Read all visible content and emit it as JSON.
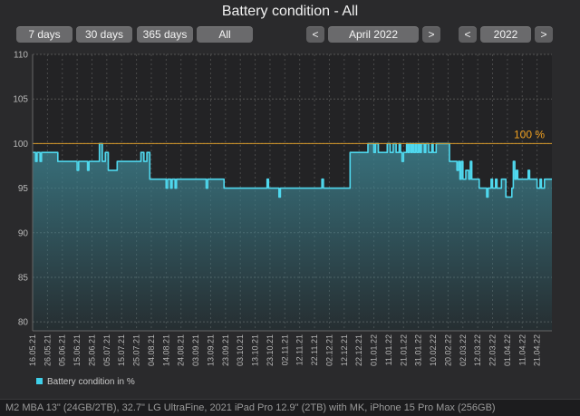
{
  "window": {
    "title": "Battery condition - All"
  },
  "range_buttons": [
    "7 days",
    "30 days",
    "365 days",
    "All"
  ],
  "month_nav": {
    "prev": "<",
    "label": "April 2022",
    "next": ">"
  },
  "year_nav": {
    "prev": "<",
    "label": "2022",
    "next": ">"
  },
  "footer_text": "M2 MBA 13\" (24GB/2TB), 32.7\" LG UltraFine, 2021 iPad Pro 12.9\" (2TB) with MK, iPhone 15 Pro Max (256GB)",
  "colors": {
    "line": "#4fd8ee",
    "fill_top": "#3c7f8c",
    "reference": "#d89a2a",
    "reference_label": "#f0a020",
    "legend_swatch": "#3fd0ea"
  },
  "chart_data": {
    "type": "area",
    "title": "Battery condition - All",
    "ylim": [
      79,
      110
    ],
    "yticks": [
      80,
      85,
      90,
      95,
      100,
      105,
      110
    ],
    "xlim": [
      "2021-05-16",
      "2022-05-01"
    ],
    "xticks": [
      "16.05.21",
      "26.05.21",
      "05.06.21",
      "15.06.21",
      "25.06.21",
      "05.07.21",
      "15.07.21",
      "25.07.21",
      "04.08.21",
      "14.08.21",
      "24.08.21",
      "03.09.21",
      "13.09.21",
      "23.09.21",
      "03.10.21",
      "13.10.21",
      "23.10.21",
      "02.11.21",
      "12.11.21",
      "22.11.21",
      "02.12.21",
      "12.12.21",
      "22.12.21",
      "01.01.22",
      "11.01.22",
      "21.01.22",
      "31.01.22",
      "10.02.22",
      "20.02.22",
      "02.03.22",
      "12.03.22",
      "22.03.22",
      "01.04.22",
      "11.04.22",
      "21.04.22"
    ],
    "grid": true,
    "reference_line": {
      "value": 100,
      "label": "100 %"
    },
    "legend": {
      "position": "bottom-left",
      "entries": [
        "Battery condition in %"
      ]
    },
    "series": [
      {
        "name": "Battery condition in %",
        "points": [
          [
            "2021-05-16",
            99
          ],
          [
            "2021-05-18",
            98
          ],
          [
            "2021-05-19",
            99
          ],
          [
            "2021-05-21",
            98
          ],
          [
            "2021-05-22",
            99
          ],
          [
            "2021-06-01",
            99
          ],
          [
            "2021-06-02",
            98
          ],
          [
            "2021-06-14",
            98
          ],
          [
            "2021-06-15",
            97
          ],
          [
            "2021-06-16",
            98
          ],
          [
            "2021-06-21",
            98
          ],
          [
            "2021-06-22",
            97
          ],
          [
            "2021-06-23",
            98
          ],
          [
            "2021-06-29",
            98
          ],
          [
            "2021-06-30",
            100
          ],
          [
            "2021-07-02",
            98
          ],
          [
            "2021-07-04",
            99
          ],
          [
            "2021-07-06",
            97
          ],
          [
            "2021-07-11",
            97
          ],
          [
            "2021-07-12",
            98
          ],
          [
            "2021-07-27",
            98
          ],
          [
            "2021-07-28",
            99
          ],
          [
            "2021-07-30",
            98
          ],
          [
            "2021-08-01",
            99
          ],
          [
            "2021-08-03",
            96
          ],
          [
            "2021-08-13",
            96
          ],
          [
            "2021-08-14",
            95
          ],
          [
            "2021-08-15",
            96
          ],
          [
            "2021-08-17",
            95
          ],
          [
            "2021-08-18",
            96
          ],
          [
            "2021-08-20",
            95
          ],
          [
            "2021-08-21",
            96
          ],
          [
            "2021-09-09",
            96
          ],
          [
            "2021-09-10",
            95
          ],
          [
            "2021-09-11",
            96
          ],
          [
            "2021-09-20",
            96
          ],
          [
            "2021-09-22",
            95
          ],
          [
            "2021-10-20",
            95
          ],
          [
            "2021-10-21",
            96
          ],
          [
            "2021-10-22",
            95
          ],
          [
            "2021-10-28",
            95
          ],
          [
            "2021-10-29",
            94
          ],
          [
            "2021-10-30",
            95
          ],
          [
            "2021-11-26",
            95
          ],
          [
            "2021-11-27",
            96
          ],
          [
            "2021-11-28",
            95
          ],
          [
            "2021-12-14",
            95
          ],
          [
            "2021-12-16",
            99
          ],
          [
            "2021-12-27",
            99
          ],
          [
            "2021-12-28",
            100
          ],
          [
            "2021-12-31",
            100
          ],
          [
            "2022-01-01",
            99
          ],
          [
            "2022-01-02",
            100
          ],
          [
            "2022-01-04",
            99
          ],
          [
            "2022-01-09",
            99
          ],
          [
            "2022-01-10",
            100
          ],
          [
            "2022-01-12",
            99
          ],
          [
            "2022-01-14",
            100
          ],
          [
            "2022-01-16",
            99
          ],
          [
            "2022-01-18",
            100
          ],
          [
            "2022-01-19",
            99
          ],
          [
            "2022-01-20",
            98
          ],
          [
            "2022-01-21",
            99
          ],
          [
            "2022-01-23",
            100
          ],
          [
            "2022-01-24",
            99
          ],
          [
            "2022-01-25",
            100
          ],
          [
            "2022-01-26",
            99
          ],
          [
            "2022-01-27",
            100
          ],
          [
            "2022-01-28",
            99
          ],
          [
            "2022-01-29",
            100
          ],
          [
            "2022-01-30",
            99
          ],
          [
            "2022-01-31",
            100
          ],
          [
            "2022-02-01",
            99
          ],
          [
            "2022-02-02",
            100
          ],
          [
            "2022-02-04",
            99
          ],
          [
            "2022-02-05",
            100
          ],
          [
            "2022-02-07",
            99
          ],
          [
            "2022-02-09",
            100
          ],
          [
            "2022-02-10",
            99
          ],
          [
            "2022-02-12",
            100
          ],
          [
            "2022-02-20",
            100
          ],
          [
            "2022-02-21",
            98
          ],
          [
            "2022-02-25",
            98
          ],
          [
            "2022-02-26",
            97
          ],
          [
            "2022-02-27",
            98
          ],
          [
            "2022-02-28",
            96
          ],
          [
            "2022-03-01",
            98
          ],
          [
            "2022-03-02",
            96
          ],
          [
            "2022-03-04",
            97
          ],
          [
            "2022-03-06",
            96
          ],
          [
            "2022-03-07",
            98
          ],
          [
            "2022-03-08",
            96
          ],
          [
            "2022-03-12",
            96
          ],
          [
            "2022-03-13",
            95
          ],
          [
            "2022-03-17",
            95
          ],
          [
            "2022-03-18",
            94
          ],
          [
            "2022-03-19",
            95
          ],
          [
            "2022-03-21",
            96
          ],
          [
            "2022-03-22",
            95
          ],
          [
            "2022-03-24",
            96
          ],
          [
            "2022-03-25",
            95
          ],
          [
            "2022-03-27",
            95
          ],
          [
            "2022-03-28",
            96
          ],
          [
            "2022-03-30",
            96
          ],
          [
            "2022-03-31",
            94
          ],
          [
            "2022-04-03",
            94
          ],
          [
            "2022-04-04",
            95
          ],
          [
            "2022-04-05",
            98
          ],
          [
            "2022-04-06",
            96
          ],
          [
            "2022-04-07",
            97
          ],
          [
            "2022-04-08",
            96
          ],
          [
            "2022-04-14",
            96
          ],
          [
            "2022-04-15",
            97
          ],
          [
            "2022-04-16",
            96
          ],
          [
            "2022-04-20",
            96
          ],
          [
            "2022-04-21",
            95
          ],
          [
            "2022-04-23",
            96
          ],
          [
            "2022-04-24",
            95
          ],
          [
            "2022-04-26",
            96
          ]
        ]
      }
    ]
  }
}
